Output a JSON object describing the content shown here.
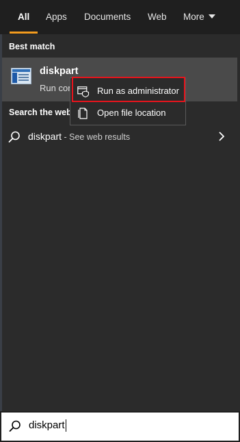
{
  "tabs": [
    {
      "label": "All",
      "active": true
    },
    {
      "label": "Apps",
      "active": false
    },
    {
      "label": "Documents",
      "active": false
    },
    {
      "label": "Web",
      "active": false
    },
    {
      "label": "More",
      "active": false
    }
  ],
  "best_match": {
    "heading": "Best match",
    "title": "diskpart",
    "subtitle": "Run command",
    "icon": "diskpart-app-icon"
  },
  "web_section": {
    "heading": "Search the web",
    "query": "diskpart",
    "suffix": " - See web results",
    "icon": "search-icon"
  },
  "context_menu": {
    "items": [
      {
        "label": "Run as administrator",
        "icon": "shield-run-icon",
        "highlighted": true
      },
      {
        "label": "Open file location",
        "icon": "file-location-icon",
        "highlighted": false
      }
    ]
  },
  "search": {
    "value": "diskpart",
    "icon": "search-icon"
  },
  "colors": {
    "accent_underline": "#f39c1f",
    "highlight_box": "#e8141c",
    "background": "#2b2b2b",
    "tabbar_bg": "#1f1f1f",
    "selected_row": "#4a4a4a"
  }
}
